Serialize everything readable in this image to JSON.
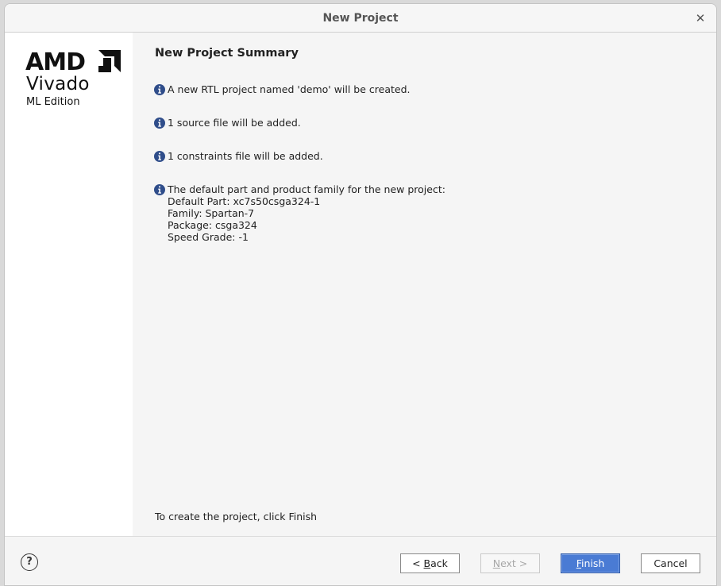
{
  "window": {
    "title": "New Project",
    "close_glyph": "✕"
  },
  "sidebar": {
    "logo_text": "AMD",
    "product": "Vivado",
    "edition": "ML Edition"
  },
  "content": {
    "heading": "New Project Summary",
    "messages": [
      {
        "icon": "info-icon",
        "text": "A new RTL project named 'demo' will be created."
      },
      {
        "icon": "info-icon",
        "text": "1 source file will be added."
      },
      {
        "icon": "info-icon",
        "text": "1 constraints file will be added."
      },
      {
        "icon": "info-icon",
        "text": "The default part and product family for the new project:",
        "details": [
          "Default Part: xc7s50csga324-1",
          "Family: Spartan-7",
          "Package: csga324",
          "Speed Grade: -1"
        ]
      }
    ],
    "footer_hint": "To create the project, click Finish"
  },
  "buttons": {
    "help_glyph": "?",
    "back": {
      "prefix": "< ",
      "mnemonic": "B",
      "rest": "ack"
    },
    "next": {
      "mnemonic": "N",
      "rest": "ext >"
    },
    "finish": {
      "mnemonic": "F",
      "rest": "inish"
    },
    "cancel": "Cancel"
  },
  "colors": {
    "accent": "#4a7bd4",
    "info_icon": "#2f4d8a"
  }
}
